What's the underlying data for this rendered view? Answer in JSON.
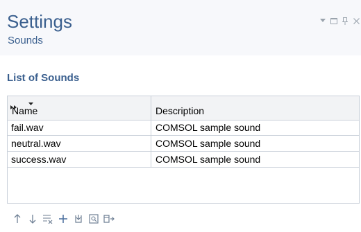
{
  "header": {
    "title": "Settings",
    "subtitle": "Sounds",
    "controls": [
      "dropdown-icon",
      "maximize-icon",
      "pin-icon",
      "close-icon"
    ]
  },
  "section": {
    "title": "List of Sounds"
  },
  "table": {
    "columns": [
      "Name",
      "Description"
    ],
    "rows": [
      {
        "name": "fail.wav",
        "description": "COMSOL sample sound"
      },
      {
        "name": "neutral.wav",
        "description": "COMSOL sample sound"
      },
      {
        "name": "success.wav",
        "description": "COMSOL sample sound"
      }
    ]
  },
  "toolbar": {
    "buttons": [
      "move-up-icon",
      "move-down-icon",
      "delete-icon",
      "add-icon",
      "replace-icon",
      "preview-icon",
      "open-icon"
    ]
  },
  "colors": {
    "title": "#3a5f8e",
    "header_bg": "#f7f8fb",
    "grid_border": "#c9d0d9",
    "toolbar_icon": "#4a6f9e"
  }
}
